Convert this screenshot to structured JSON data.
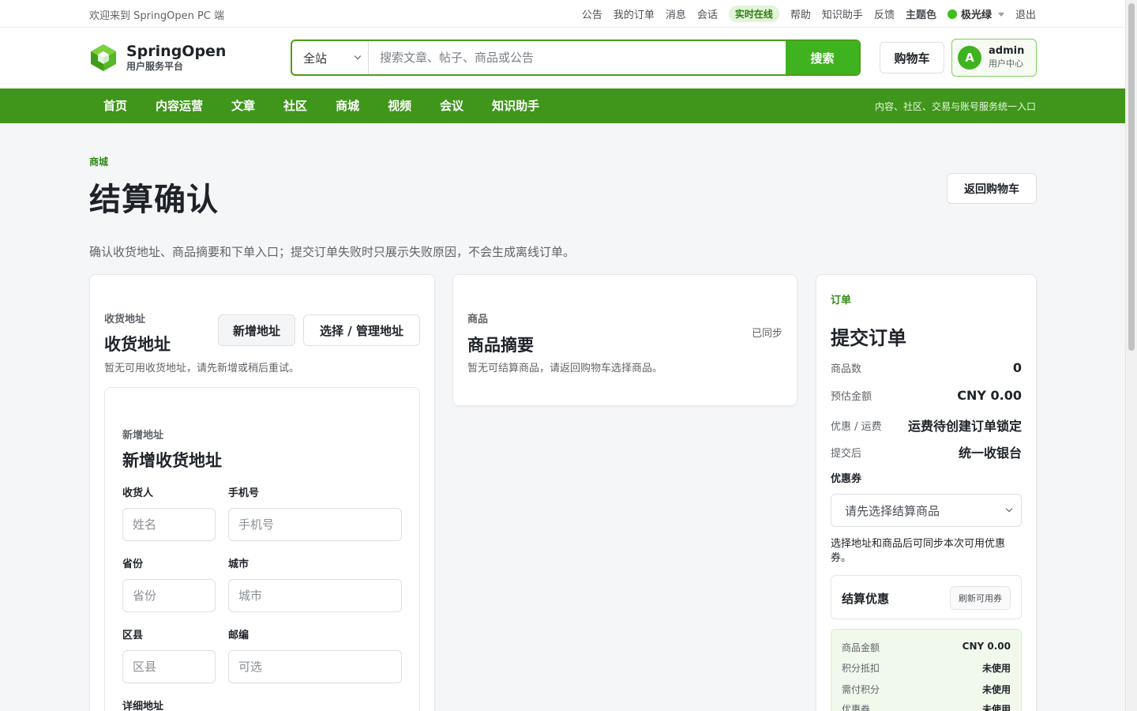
{
  "topbar": {
    "welcome": "欢迎来到 SpringOpen PC 端",
    "links": [
      "公告",
      "我的订单",
      "消息",
      "会话"
    ],
    "online_status": "实时在线",
    "links2": [
      "帮助",
      "知识助手",
      "反馈"
    ],
    "theme_label": "主题色",
    "theme_name": "极光绿",
    "logout": "退出"
  },
  "header": {
    "brand_name": "SpringOpen",
    "brand_sub": "用户服务平台",
    "search_scope": "全站",
    "search_placeholder": "搜索文章、帖子、商品或公告",
    "search_button": "搜索",
    "cart_button": "购物车",
    "user_initial": "A",
    "user_name": "admin",
    "user_center": "用户中心"
  },
  "nav": {
    "items": [
      "首页",
      "内容运营",
      "文章",
      "社区",
      "商城",
      "视频",
      "会议",
      "知识助手"
    ],
    "slogan": "内容、社区、交易与账号服务统一入口"
  },
  "page": {
    "breadcrumb": "商城",
    "title": "结算确认",
    "back_button": "返回购物车",
    "description": "确认收货地址、商品摘要和下单入口；提交订单失败时只展示失败原因，不会生成离线订单。"
  },
  "address_card": {
    "eyebrow": "收货地址",
    "title": "收货地址",
    "add_button": "新增地址",
    "manage_button": "选择 / 管理地址",
    "empty_text": "暂无可用收货地址，请先新增或稍后重试。",
    "form": {
      "eyebrow": "新增地址",
      "title": "新增收货地址",
      "receiver_label": "收货人",
      "receiver_placeholder": "姓名",
      "phone_label": "手机号",
      "phone_placeholder": "手机号",
      "province_label": "省份",
      "province_placeholder": "省份",
      "city_label": "城市",
      "city_placeholder": "城市",
      "district_label": "区县",
      "district_placeholder": "区县",
      "zip_label": "邮编",
      "zip_placeholder": "可选",
      "detail_label": "详细地址"
    }
  },
  "goods_card": {
    "eyebrow": "商品",
    "title": "商品摘要",
    "sync_status": "已同步",
    "empty_text": "暂无可结算商品，请返回购物车选择商品。"
  },
  "order_card": {
    "eyebrow": "订单",
    "title": "提交订单",
    "rows": [
      {
        "label": "商品数",
        "value": "0"
      },
      {
        "label": "预估金额",
        "value": "CNY 0.00"
      },
      {
        "label": "优惠 / 运费",
        "value": "运费待创建订单锁定"
      },
      {
        "label": "提交后",
        "value": "统一收银台"
      }
    ],
    "coupon_label": "优惠券",
    "coupon_select": "请先选择结算商品",
    "coupon_hint": "选择地址和商品后可同步本次可用优惠券。",
    "promo_title": "结算优惠",
    "promo_refresh": "刷新可用券",
    "breakdown": [
      {
        "label": "商品金额",
        "value": "CNY 0.00"
      },
      {
        "label": "积分抵扣",
        "value": "未使用"
      },
      {
        "label": "需付积分",
        "value": "未使用"
      },
      {
        "label": "优惠券",
        "value": "未使用"
      }
    ]
  },
  "colors": {
    "brand_green": "#3f961a",
    "button_green": "#3fb21f",
    "accent_text": "#2e8b14"
  }
}
